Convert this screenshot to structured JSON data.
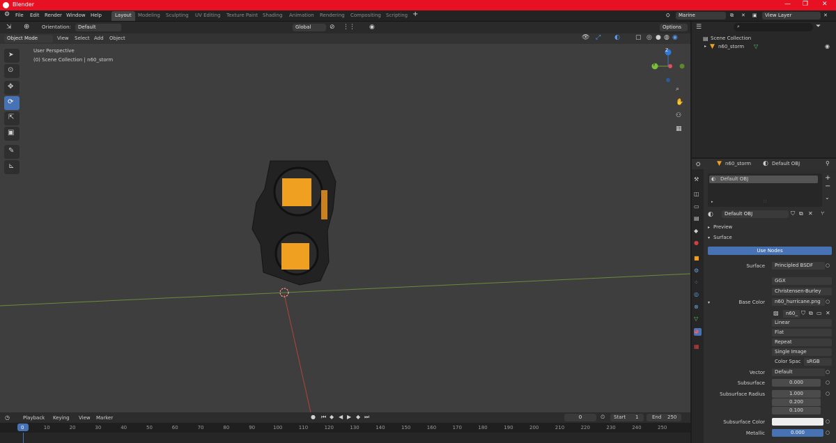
{
  "window": {
    "title": "Blender"
  },
  "menu": [
    "File",
    "Edit",
    "Render",
    "Window",
    "Help"
  ],
  "workspaces": [
    "Layout",
    "Modeling",
    "Sculpting",
    "UV Editing",
    "Texture Paint",
    "Shading",
    "Animation",
    "Rendering",
    "Compositing",
    "Scripting"
  ],
  "active_workspace": "Layout",
  "scene": {
    "name": "Marine",
    "view_layer": "View Layer"
  },
  "viewport_header": {
    "orientation_label": "Orientation:",
    "orientation_value": "Default",
    "transform_space": "Global",
    "options_label": "Options"
  },
  "viewport_menu": {
    "mode": "Object Mode",
    "items": [
      "View",
      "Select",
      "Add",
      "Object"
    ]
  },
  "viewport_overlay": {
    "line1": "User Perspective",
    "line2": "(0) Scene Collection | n60_storm"
  },
  "gizmo": {
    "z": "Z",
    "y": "Y"
  },
  "outliner": {
    "root": "Scene Collection",
    "object": "n60_storm"
  },
  "properties": {
    "object_name": "n60_storm",
    "material_name": "Default OBJ",
    "slot_name": "Default OBJ",
    "panel_preview": "Preview",
    "panel_surface": "Surface",
    "use_nodes_label": "Use Nodes",
    "rows": [
      {
        "label": "Surface",
        "value": "Principled BSDF"
      },
      {
        "label": "",
        "value": "GGX"
      },
      {
        "label": "",
        "value": "Christensen-Burley"
      },
      {
        "label": "Base Color",
        "value": "n60_hurricane.png"
      }
    ],
    "image_short": "n60_",
    "image_options": [
      "Linear",
      "Flat",
      "Repeat",
      "Single Image"
    ],
    "color_space_label": "Color Spac",
    "color_space_value": "sRGB",
    "vector_label": "Vector",
    "vector_value": "Default",
    "subsurface_label": "Subsurface",
    "subsurface_value": "0.000",
    "subsurface_radius_label": "Subsurface Radius",
    "subsurface_radius": [
      "1.000",
      "0.200",
      "0.100"
    ],
    "subsurface_color_label": "Subsurface Color",
    "metallic_label": "Metallic",
    "metallic_value": "0.000"
  },
  "timeline": {
    "menu": [
      "Playback",
      "Keying",
      "View",
      "Marker"
    ],
    "current_frame": "0",
    "start_label": "Start",
    "start_value": "1",
    "end_label": "End",
    "end_value": "250",
    "ticks": [
      "0",
      "10",
      "20",
      "30",
      "40",
      "50",
      "60",
      "70",
      "80",
      "90",
      "100",
      "110",
      "120",
      "130",
      "140",
      "150",
      "160",
      "170",
      "180",
      "190",
      "200",
      "210",
      "220",
      "230",
      "240",
      "250"
    ]
  },
  "colors": {
    "accent": "#4772b3",
    "titlebar": "#e81123",
    "viewport": "#3e3e3e",
    "object_orange": "#f0a020"
  }
}
